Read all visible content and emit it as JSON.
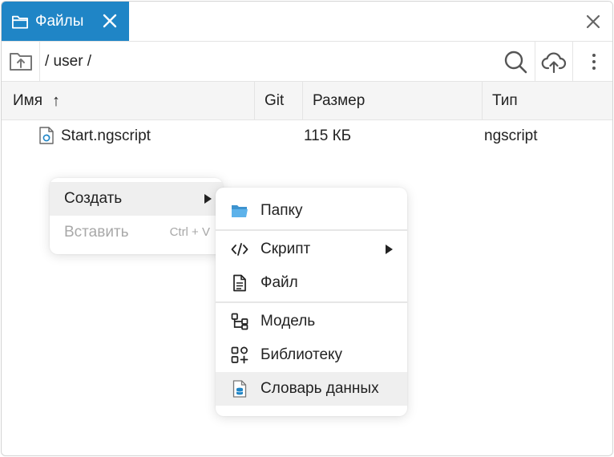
{
  "tab": {
    "label": "Файлы",
    "icon": "folder-icon",
    "color": "#1f85c6"
  },
  "pathbar": {
    "path": "/ user /"
  },
  "columns": {
    "name": "Имя",
    "git": "Git",
    "size": "Размер",
    "type": "Тип",
    "sort_indicator": "↑"
  },
  "files": [
    {
      "name": "Start.ngscript",
      "size": "115 КБ",
      "type": "ngscript"
    }
  ],
  "context_menu": {
    "create": "Создать",
    "paste": "Вставить",
    "paste_shortcut": "Ctrl + V"
  },
  "create_submenu": {
    "folder": "Папку",
    "script": "Скрипт",
    "file": "Файл",
    "model": "Модель",
    "library": "Библиотеку",
    "data_dictionary": "Словарь данных"
  },
  "colors": {
    "accent": "#1f85c6",
    "folder": "#4aa3df",
    "hover": "#efefef"
  }
}
